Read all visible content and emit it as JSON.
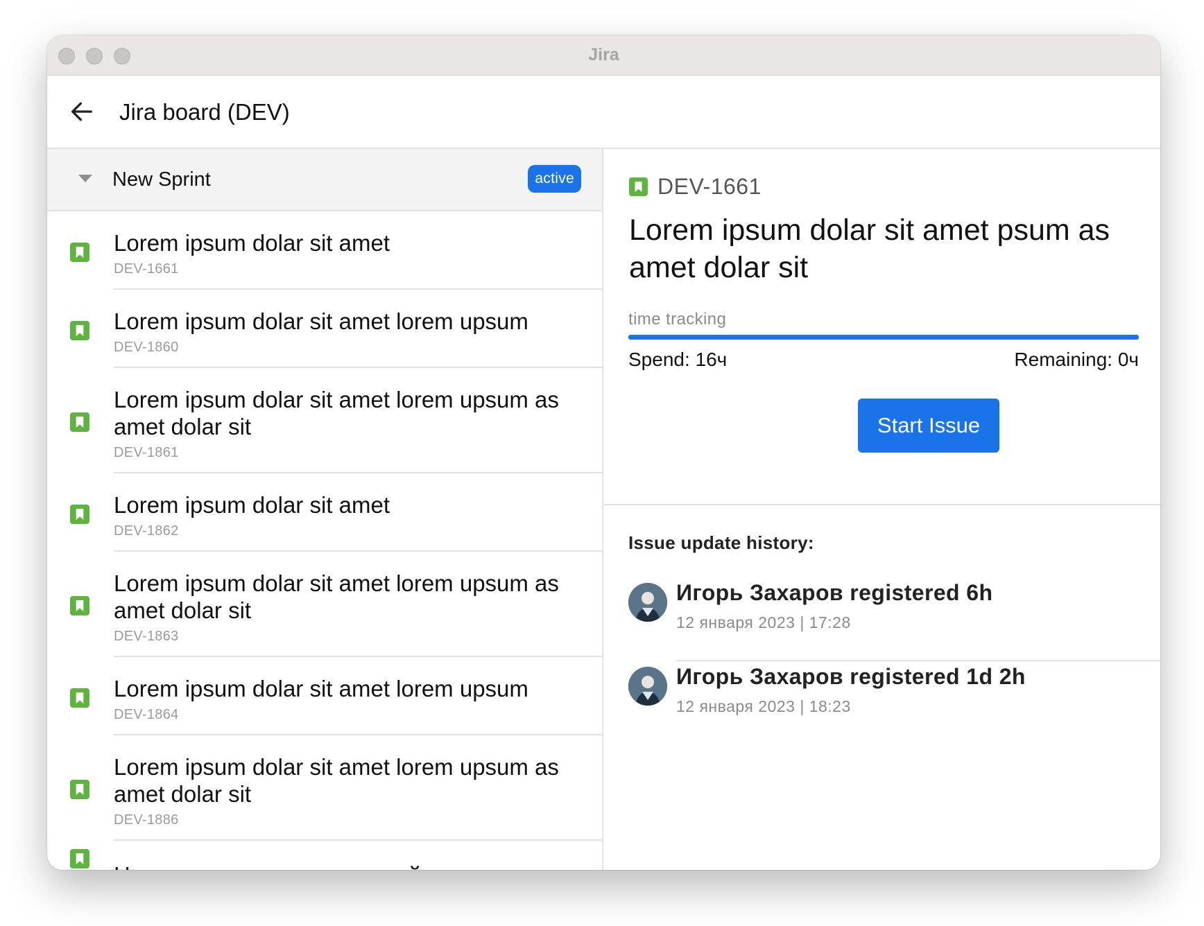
{
  "window": {
    "title": "Jira"
  },
  "appbar": {
    "back_icon": "arrow-left-icon",
    "title": "Jira board (DEV)"
  },
  "sprint": {
    "name": "New Sprint",
    "badge": "active"
  },
  "issues": [
    {
      "title": "Lorem ipsum dolar sit amet",
      "key": "DEV-1661"
    },
    {
      "title": "Lorem ipsum dolar sit amet lorem upsum",
      "key": "DEV-1860"
    },
    {
      "title": "Lorem ipsum dolar sit amet lorem upsum as amet dolar sit",
      "key": "DEV-1861"
    },
    {
      "title": "Lorem ipsum dolar sit amet",
      "key": "DEV-1862"
    },
    {
      "title": "Lorem ipsum dolar sit amet lorem upsum as amet dolar sit",
      "key": "DEV-1863"
    },
    {
      "title": "Lorem ipsum dolar sit amet lorem upsum",
      "key": "DEV-1864"
    },
    {
      "title": "Lorem ipsum dolar sit amet lorem upsum as amet dolar sit",
      "key": "DEV-1886"
    },
    {
      "title": "Написать сохранение статей для",
      "key": ""
    }
  ],
  "detail": {
    "key": "DEV-1661",
    "title": "Lorem ipsum dolar sit amet psum as amet dolar sit",
    "time_tracking_label": "time tracking",
    "progress": 1.0,
    "spend": "Spend: 16ч",
    "remaining": "Remaining: 0ч",
    "start_button": "Start Issue"
  },
  "history": {
    "title": "Issue update history:",
    "items": [
      {
        "text": "Игорь Захаров registered 6h",
        "date": "12 января 2023 | 17:28"
      },
      {
        "text": "Игорь Захаров registered 1d 2h",
        "date": "12 января 2023 | 18:23"
      }
    ]
  },
  "colors": {
    "accent": "#1a73e8",
    "story": "#5fb33f"
  }
}
